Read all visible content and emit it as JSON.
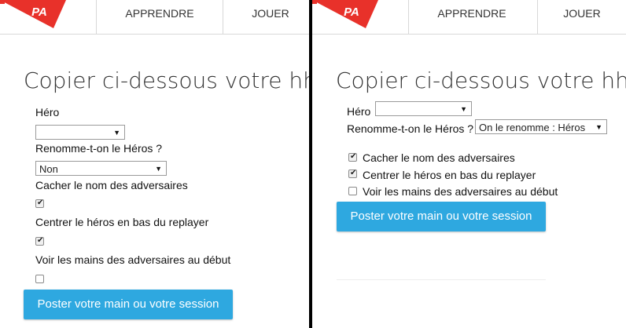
{
  "nav": {
    "items": [
      "APPRENDRE",
      "JOUER"
    ],
    "logo_text": "PA"
  },
  "form": {
    "title": "Copier ci-dessous votre hh",
    "hero_label": "Héro",
    "hero_value": "",
    "rename_label": "Renomme-t-on le Héros ?",
    "rename_value_left": "Non",
    "rename_value_right": "On le renomme : Héros",
    "options": [
      {
        "label": "Cacher le nom des adversaires",
        "checked": true
      },
      {
        "label": "Centrer le héros en bas du replayer",
        "checked": true
      },
      {
        "label": "Voir les mains des adversaires au début",
        "checked": false
      }
    ],
    "submit_label": "Poster votre main ou votre session"
  },
  "colors": {
    "accent": "#2ea8e0",
    "logo_red": "#e8312a",
    "divider": "#000000"
  }
}
